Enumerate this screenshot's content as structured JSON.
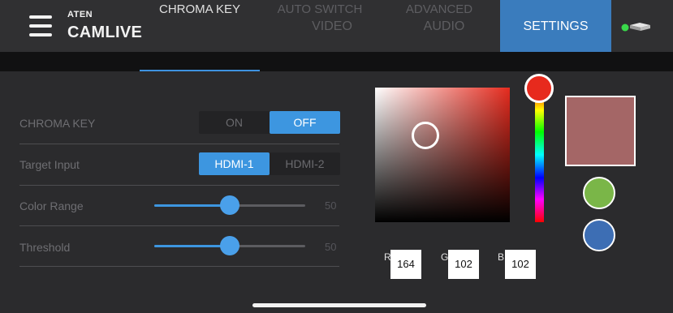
{
  "header": {
    "brand_small": "ATEN",
    "brand_name": "CAMLIVE",
    "tabs": [
      "VIDEO",
      "AUDIO",
      "SETTINGS"
    ],
    "active_tab": "SETTINGS"
  },
  "subtabs": {
    "items": [
      "CHROMA KEY",
      "AUTO SWITCH",
      "ADVANCED"
    ],
    "active": "CHROMA KEY"
  },
  "settings": {
    "chroma_key": {
      "label": "CHROMA KEY",
      "on": "ON",
      "off": "OFF",
      "selected": "OFF"
    },
    "target_input": {
      "label": "Target Input",
      "options": [
        "HDMI-1",
        "HDMI-2"
      ],
      "selected": "HDMI-1"
    },
    "color_range": {
      "label": "Color Range",
      "value": "50",
      "fraction": 0.5
    },
    "threshold": {
      "label": "Threshold",
      "value": "50",
      "fraction": 0.5
    }
  },
  "color": {
    "r_label": "R",
    "g_label": "G",
    "b_label": "B",
    "r": "164",
    "g": "102",
    "b": "102",
    "selected_hex": "#a46666",
    "hue_hex": "#e52b1e",
    "presets": [
      "#7ab648",
      "#3d6eb4"
    ]
  },
  "icons": {
    "menu": "hamburger-menu-icon",
    "status": "device-connected-icon"
  }
}
